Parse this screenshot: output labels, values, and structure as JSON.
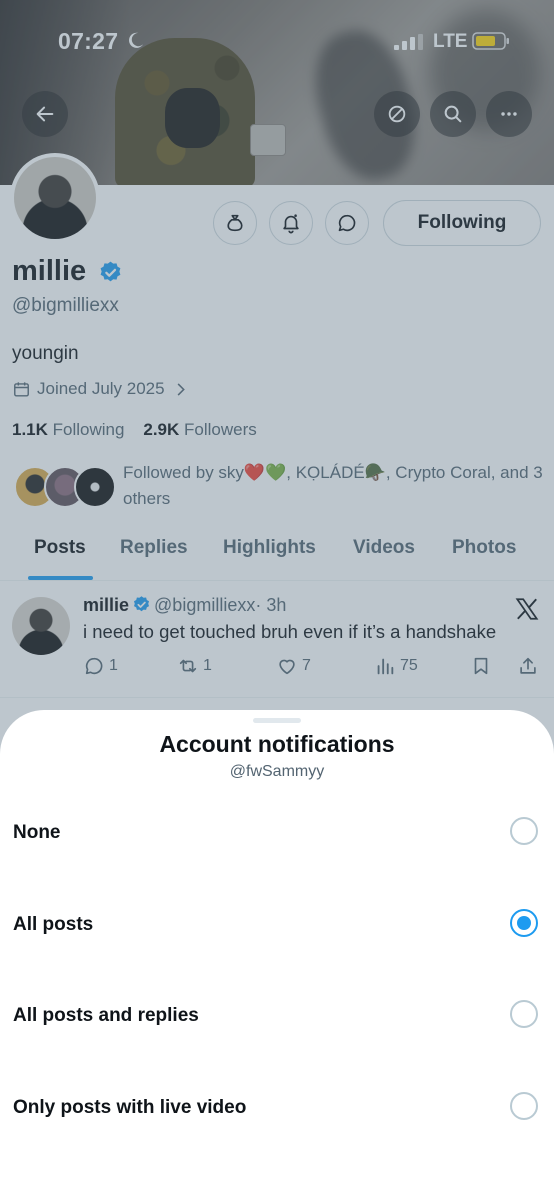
{
  "status_bar": {
    "time": "07:27",
    "network": "LTE"
  },
  "profile": {
    "display_name": "millie",
    "handle": "@bigmilliexx",
    "bio": "youngin",
    "joined": "Joined July 2025",
    "following_count": "1.1K",
    "following_label": "Following",
    "followers_count": "2.9K",
    "followers_label": "Followers",
    "followed_by": "Followed by sky❤️💚, KỌLÁDÉ🪖, Crypto Coral, and 3 others",
    "follow_button_label": "Following"
  },
  "tabs": [
    {
      "label": "Posts",
      "active": true
    },
    {
      "label": "Replies",
      "active": false
    },
    {
      "label": "Highlights",
      "active": false
    },
    {
      "label": "Videos",
      "active": false
    },
    {
      "label": "Photos",
      "active": false
    }
  ],
  "post": {
    "author": "millie",
    "handle": "@bigmilliexx",
    "time": "· 3h",
    "text": "i need to get touched bruh even if it’s a handshake",
    "replies": "1",
    "reposts": "1",
    "likes": "7",
    "views": "75"
  },
  "sheet": {
    "title": "Account notifications",
    "subtitle": "@fwSammyy",
    "options": [
      {
        "label": "None",
        "selected": false
      },
      {
        "label": "All posts",
        "selected": true
      },
      {
        "label": "All posts and replies",
        "selected": false
      },
      {
        "label": "Only posts with live video",
        "selected": false
      }
    ]
  },
  "colors": {
    "accent": "#1d9bf0",
    "secondary_text": "#536471",
    "battery": "#ffd60a"
  },
  "icons": [
    "back-arrow-icon",
    "block-icon",
    "search-icon",
    "more-icon",
    "money-bag-icon",
    "bell-icon",
    "message-icon",
    "calendar-icon",
    "chevron-right-icon",
    "verified-icon",
    "x-logo-icon",
    "reply-icon",
    "repost-icon",
    "like-icon",
    "views-icon",
    "bookmark-icon",
    "share-icon"
  ]
}
